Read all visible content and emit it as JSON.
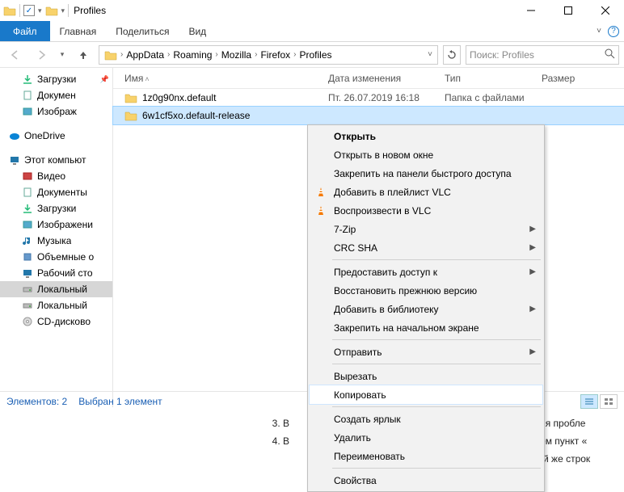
{
  "window": {
    "title": "Profiles"
  },
  "ribbon": {
    "file": "Файл",
    "tabs": [
      "Главная",
      "Поделиться",
      "Вид"
    ]
  },
  "breadcrumb": {
    "items": [
      "AppData",
      "Roaming",
      "Mozilla",
      "Firefox",
      "Profiles"
    ]
  },
  "search": {
    "placeholder": "Поиск: Profiles"
  },
  "columns": {
    "name": "Имя",
    "date": "Дата изменения",
    "type": "Тип",
    "size": "Размер"
  },
  "files": [
    {
      "name": "1z0g90nx.default",
      "date": "Пт. 26.07.2019 16:18",
      "type": "Папка с файлами"
    },
    {
      "name": "6w1cf5xo.default-release",
      "date": "",
      "type": ""
    }
  ],
  "tree": {
    "quick": [
      {
        "label": "Загрузки",
        "icon": "download"
      },
      {
        "label": "Докумен",
        "icon": "doc"
      },
      {
        "label": "Изображ",
        "icon": "image"
      }
    ],
    "onedrive": "OneDrive",
    "thispc": "Этот компьют",
    "pcitems": [
      {
        "label": "Видео",
        "icon": "video"
      },
      {
        "label": "Документы",
        "icon": "doc"
      },
      {
        "label": "Загрузки",
        "icon": "download"
      },
      {
        "label": "Изображени",
        "icon": "image"
      },
      {
        "label": "Музыка",
        "icon": "music"
      },
      {
        "label": "Объемные о",
        "icon": "3d"
      },
      {
        "label": "Рабочий сто",
        "icon": "desktop"
      },
      {
        "label": "Локальный",
        "icon": "drive",
        "selected": true
      },
      {
        "label": "Локальный",
        "icon": "drive"
      },
      {
        "label": "CD-дисково",
        "icon": "cd"
      }
    ]
  },
  "context": [
    {
      "label": "Открыть",
      "bold": true
    },
    {
      "label": "Открыть в новом окне"
    },
    {
      "label": "Закрепить на панели быстрого доступа"
    },
    {
      "label": "Добавить в плейлист VLC",
      "icon": "vlc"
    },
    {
      "label": "Воспроизвести в VLC",
      "icon": "vlc"
    },
    {
      "label": "7-Zip",
      "submenu": true
    },
    {
      "label": "CRC SHA",
      "submenu": true
    },
    {
      "sep": true
    },
    {
      "label": "Предоставить доступ к",
      "submenu": true
    },
    {
      "label": "Восстановить прежнюю версию"
    },
    {
      "label": "Добавить в библиотеку",
      "submenu": true
    },
    {
      "label": "Закрепить на начальном экране"
    },
    {
      "sep": true
    },
    {
      "label": "Отправить",
      "submenu": true
    },
    {
      "sep": true
    },
    {
      "label": "Вырезать"
    },
    {
      "label": "Копировать",
      "hover": true
    },
    {
      "sep": true
    },
    {
      "label": "Создать ярлык"
    },
    {
      "label": "Удалить"
    },
    {
      "label": "Переименовать"
    },
    {
      "sep": true
    },
    {
      "label": "Свойства"
    }
  ],
  "status": {
    "count": "Элементов: 2",
    "selected": "Выбран 1 элемент"
  },
  "bg": {
    "line1": "В",
    "line1b": "ия пробле",
    "line2": "В",
    "line2b": "ём пункт «",
    "line3": "й же строк"
  }
}
